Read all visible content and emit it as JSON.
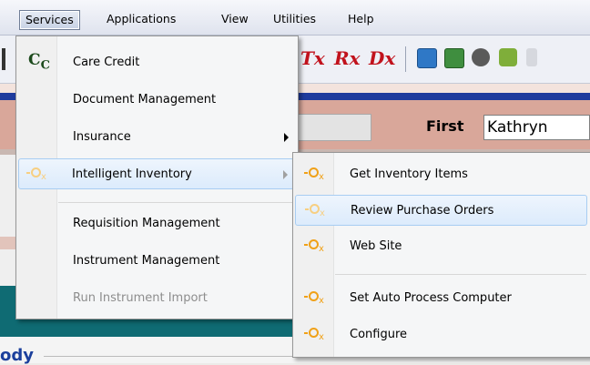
{
  "menubar": {
    "items": [
      "Services",
      "Applications",
      "View",
      "Utilities",
      "Help"
    ]
  },
  "toolbar": {
    "icons": [
      "Tx",
      "Rx",
      "Dx"
    ]
  },
  "background": {
    "first_label": "First",
    "first_value": "Kathryn",
    "body_label": "ody"
  },
  "services_menu": {
    "items": [
      {
        "label": "Care Credit",
        "icon": "cc-icon"
      },
      {
        "label": "Document Management"
      },
      {
        "label": "Insurance",
        "submenu": true
      },
      {
        "label": "Intelligent Inventory",
        "icon": "intelligent-inventory-icon",
        "submenu": true,
        "highlighted": true
      },
      {
        "label": "Requisition Management"
      },
      {
        "label": "Instrument Management"
      },
      {
        "label": "Run Instrument Import",
        "disabled": true
      }
    ],
    "cc_glyph": "C",
    "cc_sub": "C"
  },
  "inventory_menu": {
    "items": [
      {
        "label": "Get Inventory Items"
      },
      {
        "label": "Review Purchase Orders",
        "highlighted": true
      },
      {
        "label": "Web Site"
      },
      {
        "label": "Set Auto Process Computer"
      },
      {
        "label": "Configure"
      }
    ],
    "icon_glyph": "x"
  },
  "colors": {
    "accent_red": "#c1121c",
    "salmon": "#d9a79a",
    "teal": "#0f6b73",
    "menu_highlight": "#dcebfc",
    "icon_orange": "#f0a118"
  }
}
